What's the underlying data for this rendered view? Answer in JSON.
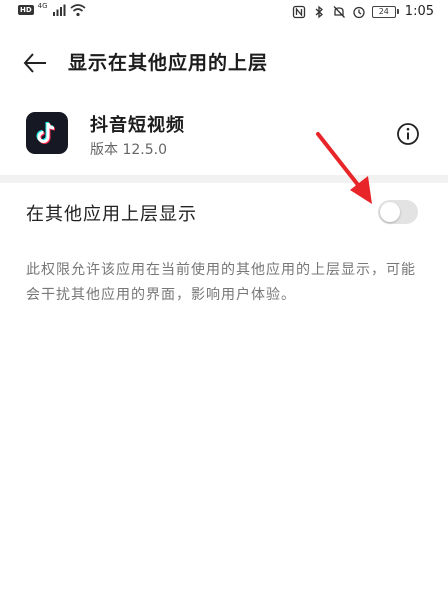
{
  "status_bar": {
    "hd_label": "HD",
    "signal_label": "4G",
    "battery_level": "24",
    "time": "1:05"
  },
  "header": {
    "title": "显示在其他应用的上层"
  },
  "app": {
    "name": "抖音短视频",
    "version": "版本 12.5.0"
  },
  "setting": {
    "label": "在其他应用上层显示",
    "enabled": false,
    "description": "此权限允许该应用在当前使用的其他应用的上层显示，可能会干扰其他应用的界面，影响用户体验。"
  },
  "colors": {
    "arrow": "#e8262a",
    "switch_off_track": "#e3e3e3",
    "app_icon_bg": "#161823"
  }
}
